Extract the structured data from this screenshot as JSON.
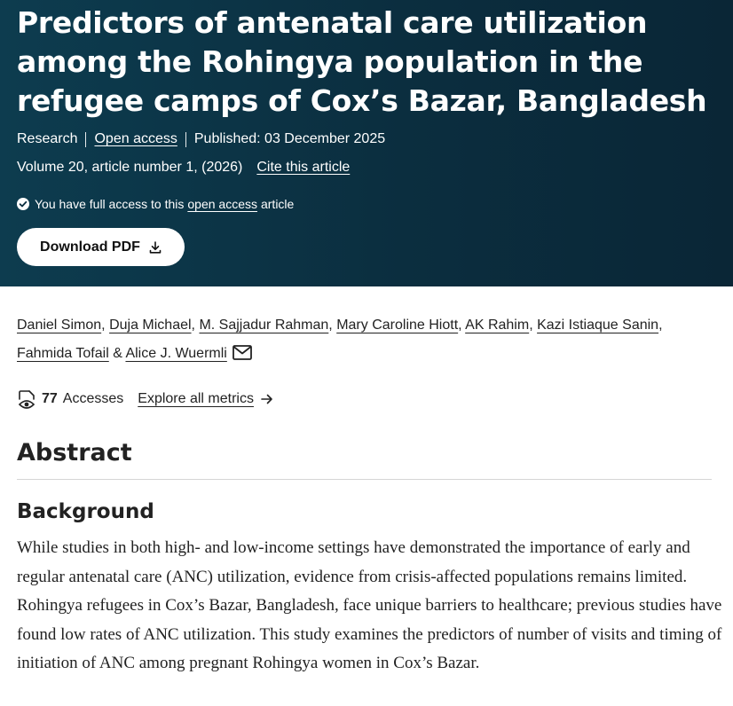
{
  "article": {
    "title": "Predictors of antenatal care utilization among the Rohingya population in the refugee camps of Cox’s Bazar, Bangladesh",
    "type": "Research",
    "open_access": "Open access",
    "published": "Published: 03 December 2025",
    "volume": "Volume 20, article number 1, (2026)",
    "cite": "Cite this article"
  },
  "access_note": {
    "prefix": "You have full access to this",
    "link": "open access",
    "suffix": "article"
  },
  "download": {
    "label": "Download PDF"
  },
  "authors": [
    "Daniel Simon",
    "Duja Michael",
    "M. Sajjadur Rahman",
    "Mary Caroline Hiott",
    "AK Rahim",
    "Kazi Istiaque Sanin",
    "Fahmida Tofail",
    "Alice J. Wuermli"
  ],
  "author_separators": {
    "comma": ",",
    "ampersand": "&"
  },
  "metrics": {
    "accesses_count": "77",
    "accesses_label": "Accesses",
    "explore": "Explore all metrics"
  },
  "abstract": {
    "heading": "Abstract",
    "background_heading": "Background",
    "background_text": "While studies in both high- and low-income settings have demonstrated the importance of early and regular antenatal care (ANC) utilization, evidence from crisis-affected populations remains limited. Rohingya refugees in Cox’s Bazar, Bangladesh, face unique barriers to healthcare; previous studies have found low rates of ANC utilization. This study examines the predictors of number of visits and timing of initiation of ANC among pregnant Rohingya women in Cox’s Bazar."
  },
  "icons": {
    "check": "check-circle-icon",
    "download": "download-icon",
    "mail": "mail-icon",
    "eye": "eye-document-icon",
    "arrow": "arrow-right-icon"
  },
  "colors": {
    "hero_background": "#0b2e3f",
    "text": "#222222",
    "white": "#ffffff"
  }
}
